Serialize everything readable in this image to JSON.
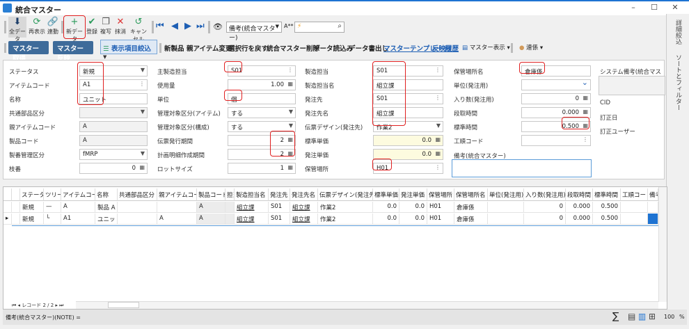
{
  "window": {
    "title": "統合マスター",
    "minimize": "–",
    "maximize": "☐",
    "close": "✕"
  },
  "toolbar": {
    "all_data": "全データ",
    "refresh": "再表示",
    "link": "連動",
    "new_data": "新データ",
    "register": "登録",
    "copy": "複写",
    "erase": "抹消",
    "cancel": "キャンセル",
    "search_field": "備考(統合マスター)",
    "font_label": "A**",
    "search_value": ""
  },
  "toolbar2": {
    "get_master": "マスター取得",
    "apply_master": "マスター反映",
    "filter_items": "表示項目絞込",
    "commands": [
      "新製品",
      "親アイテム変更",
      "選択行を戻す",
      "統合マスター削除",
      "データ読込み",
      "データ書出し"
    ],
    "links": [
      "マスターテンプレート",
      "反映履歴"
    ],
    "master_view": "マスター表示",
    "relation": "連係"
  },
  "side_tabs": [
    "詳細絞込",
    "ソートとフィルター"
  ],
  "form": {
    "col1": [
      {
        "label": "ステータス",
        "value": "新規",
        "type": "select"
      },
      {
        "label": "アイテムコード",
        "value": "A1",
        "type": "lookup"
      },
      {
        "label": "名称",
        "value": "ユニット",
        "type": "text"
      },
      {
        "label": "共通部品区分",
        "value": "",
        "type": "select-ro"
      },
      {
        "label": "親アイテムコード",
        "value": "A",
        "type": "ro"
      },
      {
        "label": "製品コード",
        "value": "A",
        "type": "ro"
      },
      {
        "label": "製番管理区分",
        "value": "fMRP",
        "type": "select"
      },
      {
        "label": "枝番",
        "value": "0",
        "type": "num"
      }
    ],
    "col2": [
      {
        "label": "主製造担当",
        "value": "S01",
        "type": "lookup"
      },
      {
        "label": "使用量",
        "value": "1.00",
        "type": "num"
      },
      {
        "label": "単位",
        "value": "個",
        "type": "text"
      },
      {
        "label": "管理対象区分(アイテム)",
        "value": "する",
        "type": "select"
      },
      {
        "label": "管理対象区分(構成)",
        "value": "する",
        "type": "select"
      },
      {
        "label": "伝票発行期間",
        "value": "2",
        "type": "num"
      },
      {
        "label": "計画明細作成期間",
        "value": "2",
        "type": "num"
      },
      {
        "label": "ロットサイズ",
        "value": "1",
        "type": "num"
      }
    ],
    "col3": [
      {
        "label": "製造担当",
        "value": "S01",
        "type": "lookup"
      },
      {
        "label": "製造担当名",
        "value": "組立課",
        "type": "text"
      },
      {
        "label": "発注先",
        "value": "S01",
        "type": "lookup"
      },
      {
        "label": "発注先名",
        "value": "組立課",
        "type": "text"
      },
      {
        "label": "伝票デザイン(発注先)",
        "value": "作業2",
        "type": "select"
      },
      {
        "label": "標準単価",
        "value": "0.0",
        "type": "yel"
      },
      {
        "label": "発注単価",
        "value": "0.0",
        "type": "yel"
      },
      {
        "label": "保管場所",
        "value": "H01",
        "type": "lookup"
      }
    ],
    "col4": [
      {
        "label": "保管場所名",
        "value": "倉庫係",
        "type": "text"
      },
      {
        "label": "単位(発注用)",
        "value": "",
        "type": "chev"
      },
      {
        "label": "入り数(発注用)",
        "value": "0",
        "type": "num"
      },
      {
        "label": "段取時間",
        "value": "0.000",
        "type": "num"
      },
      {
        "label": "標準時間",
        "value": "0.500",
        "type": "num"
      },
      {
        "label": "工順コード",
        "value": "",
        "type": "lookup"
      }
    ],
    "note_label": "備考(統合マスター)",
    "note_value": "",
    "col5": {
      "system_note": "システム備考(統合マスター)",
      "cid": "CID",
      "revised_date": "訂正日",
      "revised_user": "訂正ユーザー"
    }
  },
  "grid": {
    "columns": [
      "",
      "",
      "ステータス",
      "ツリー",
      "アイテムコード",
      "名称",
      "共通部品区分",
      "親アイテムコード",
      "製品コード",
      "担当",
      "製造担当名",
      "発注先",
      "発注先名",
      "伝票デザイン(発注先)",
      "標準単価",
      "発注単価",
      "保管場所",
      "保管場所名",
      "単位(発注用)",
      "入り数(発注用)",
      "段取時間",
      "標準時間",
      "工順コード",
      "備考"
    ],
    "rows": [
      [
        "",
        "",
        "新規",
        "—",
        "A",
        "製品 A",
        "",
        "",
        "A",
        "",
        "組立課",
        "S01",
        "組立課",
        "作業2",
        "0.0",
        "0.0",
        "H01",
        "倉庫係",
        "",
        "0",
        "0.000",
        "0.500",
        "",
        ""
      ],
      [
        "▸",
        "",
        "新規",
        "└",
        "A1",
        "ユニット",
        "",
        "A",
        "A",
        "",
        "組立課",
        "S01",
        "組立課",
        "作業2",
        "0.0",
        "0.0",
        "H01",
        "倉庫係",
        "",
        "0",
        "0.000",
        "0.500",
        "",
        ""
      ]
    ],
    "selected_row": 1,
    "record_nav": "レコード 2 / 2"
  },
  "status": {
    "note": "備考(統合マスター)(NOTE) =",
    "zoom": "100",
    "percent": "%"
  },
  "colors": {
    "accent": "#1e73d2",
    "button": "#3e6b9a",
    "highlight": "#e02020",
    "selected_cell": "#1e73d2"
  }
}
